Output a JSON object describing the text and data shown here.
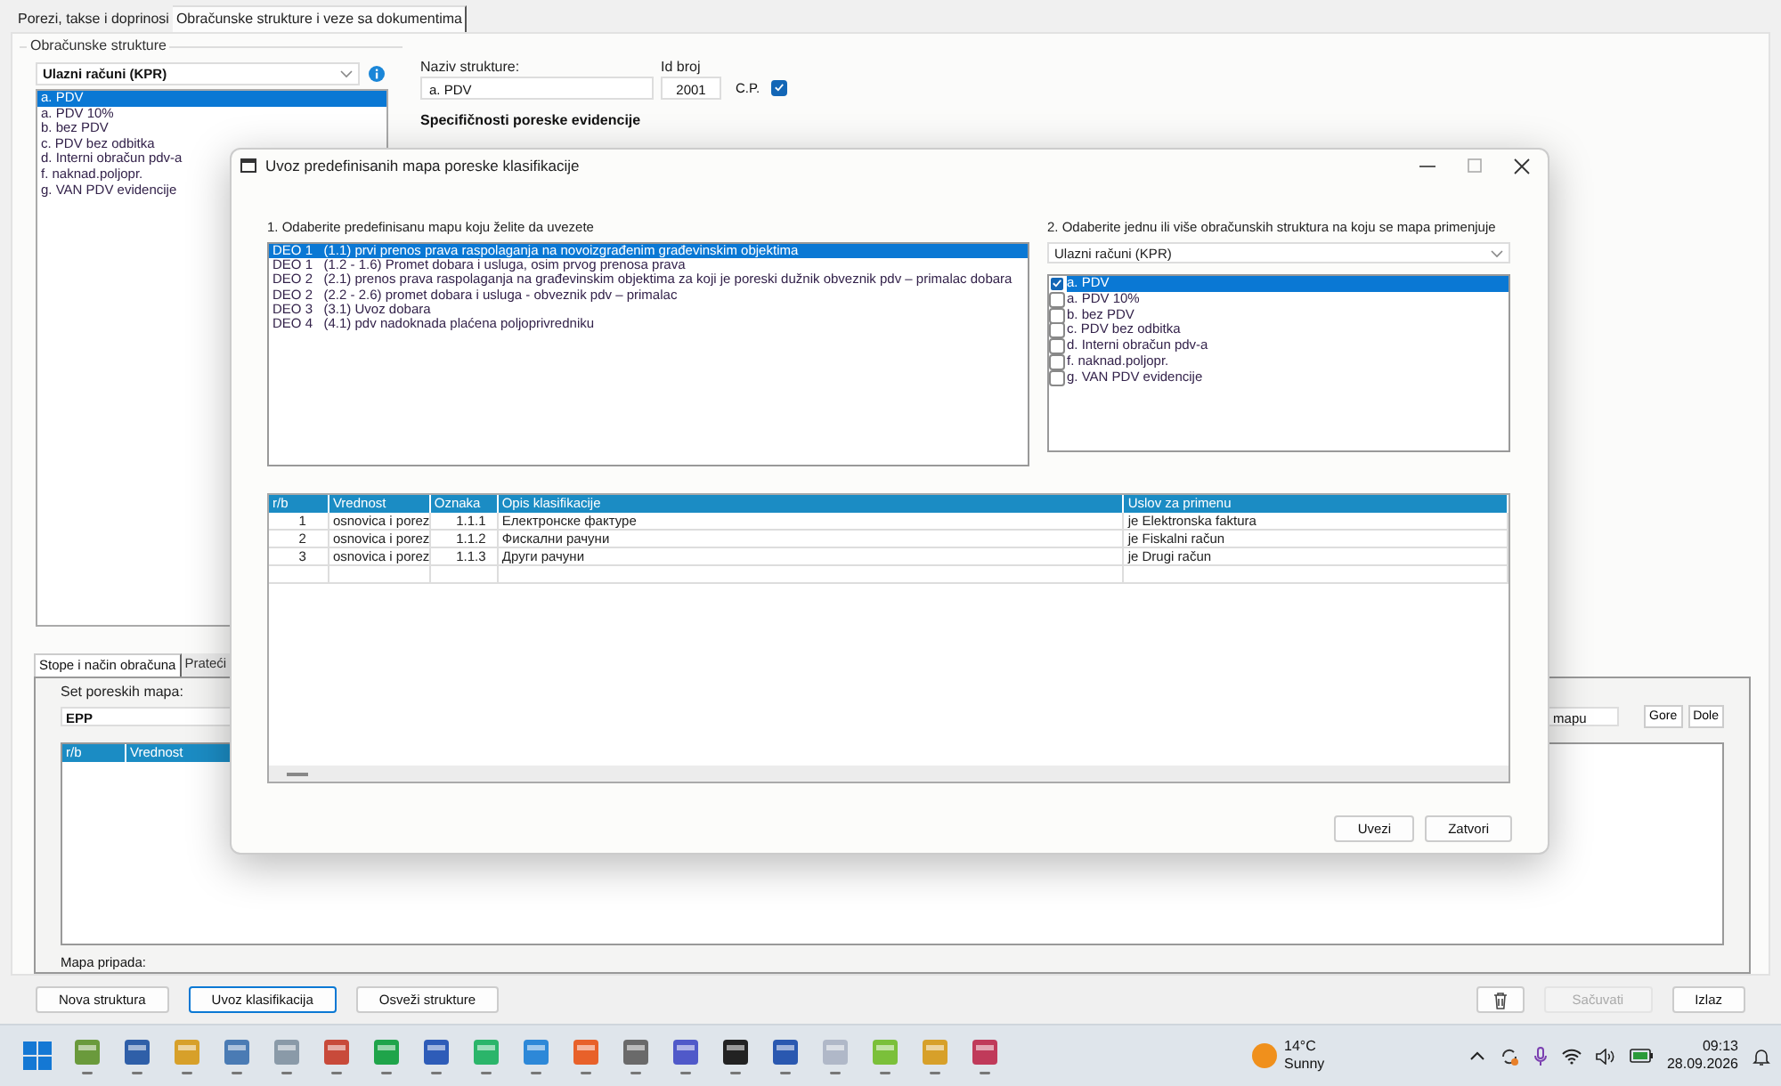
{
  "app": {
    "tabs": [
      {
        "label": "Porezi, takse i doprinosi",
        "selected": false
      },
      {
        "label": "Obračunske strukture i veze sa dokumentima",
        "selected": true
      }
    ],
    "structures": {
      "title": "Obračunske strukture",
      "combo": "Ulazni računi (KPR)",
      "items": [
        {
          "label": "a. PDV",
          "selected": true
        },
        {
          "label": "a. PDV 10%",
          "selected": false
        },
        {
          "label": "b. bez PDV",
          "selected": false
        },
        {
          "label": "c. PDV bez odbitka",
          "selected": false
        },
        {
          "label": "d. Interni obračun pdv-a",
          "selected": false
        },
        {
          "label": "f. naknad.poljopr.",
          "selected": false
        },
        {
          "label": "g. VAN PDV evidencije",
          "selected": false
        }
      ]
    },
    "details": {
      "name_label": "Naziv strukture:",
      "name_value": "a. PDV",
      "id_label": "Id broj",
      "id_value": "2001",
      "cp_label": "C.P.",
      "cp_checked": true,
      "section_title": "Specifičnosti poreske evidencije"
    },
    "lower_tabs": [
      {
        "label": "Stope i način obračuna",
        "selected": true
      },
      {
        "label": "Prateći",
        "selected": false
      }
    ],
    "lower": {
      "set_label": "Set poreskih mapa:",
      "set_value": "EPP",
      "columns": [
        "r/b",
        "Vrednost"
      ],
      "search_value": "mapu",
      "buttons": [
        "Gore",
        "Dole"
      ],
      "owner_label": "Mapa pripada:"
    },
    "left_buttons": [
      {
        "label": "Nova struktura",
        "focused": false
      },
      {
        "label": "Uvoz klasifikacija",
        "focused": true
      },
      {
        "label": "Osveži strukture",
        "focused": false
      }
    ],
    "right_buttons": [
      {
        "kind": "icon",
        "disabled": false
      },
      {
        "kind": "text",
        "label": "Sačuvati",
        "disabled": true
      },
      {
        "kind": "text",
        "label": "Izlaz",
        "disabled": false
      }
    ]
  },
  "dialog": {
    "title": "Uvoz predefinisanih mapa poreske klasifikacije",
    "maps_label": "1. Odaberite predefinisanu mapu koju želite da uvezete",
    "maps": [
      {
        "label": "DEO 1   (1.1) prvi prenos prava raspolaganja na novoizgrađenim građevinskim objektima",
        "selected": true
      },
      {
        "label": "DEO 1   (1.2 - 1.6) Promet dobara i usluga, osim prvog prenosa prava",
        "selected": false
      },
      {
        "label": "DEO 2   (2.1) prenos prava raspolaganja na građevinskim objektima za koji je poreski dužnik obveznik pdv – primalac dobara",
        "selected": false
      },
      {
        "label": "DEO 2   (2.2 - 2.6) promet dobara i usluga - obveznik pdv – primalac",
        "selected": false
      },
      {
        "label": "DEO 3   (3.1) Uvoz dobara",
        "selected": false
      },
      {
        "label": "DEO 4   (4.1) pdv nadoknada plaćena poljoprivredniku",
        "selected": false
      }
    ],
    "structures_label": "2. Odaberite jednu ili više obračunskih struktura na koju se mapa primenjuje",
    "combo": "Ulazni računi (KPR)",
    "structures": [
      {
        "label": "a. PDV",
        "checked": true,
        "selected": true
      },
      {
        "label": "a. PDV 10%",
        "checked": false,
        "selected": false
      },
      {
        "label": "b. bez PDV",
        "checked": false,
        "selected": false
      },
      {
        "label": "c. PDV bez odbitka",
        "checked": false,
        "selected": false
      },
      {
        "label": "d. Interni obračun pdv-a",
        "checked": false,
        "selected": false
      },
      {
        "label": "f. naknad.poljopr.",
        "checked": false,
        "selected": false
      },
      {
        "label": "g. VAN PDV evidencije",
        "checked": false,
        "selected": false
      }
    ],
    "table": {
      "columns": [
        "r/b",
        "Vrednost",
        "Oznaka",
        "Opis klasifikacije",
        "Uslov za primenu"
      ],
      "rows": [
        [
          "1",
          "osnovica i porez",
          "1.1.1",
          "Електронске фактуре",
          "je Elektronska faktura"
        ],
        [
          "2",
          "osnovica i porez",
          "1.1.2",
          "Фискални рачуни",
          "je Fiskalni račun"
        ],
        [
          "3",
          "osnovica i porez",
          "1.1.3",
          "Други рачуни",
          "je Drugi račun"
        ]
      ]
    },
    "buttons": [
      "Uvezi",
      "Zatvori"
    ]
  },
  "taskbar": {
    "temperature": "14°C",
    "condition": "Sunny",
    "time": "09:13",
    "date": "28.09.2026"
  }
}
